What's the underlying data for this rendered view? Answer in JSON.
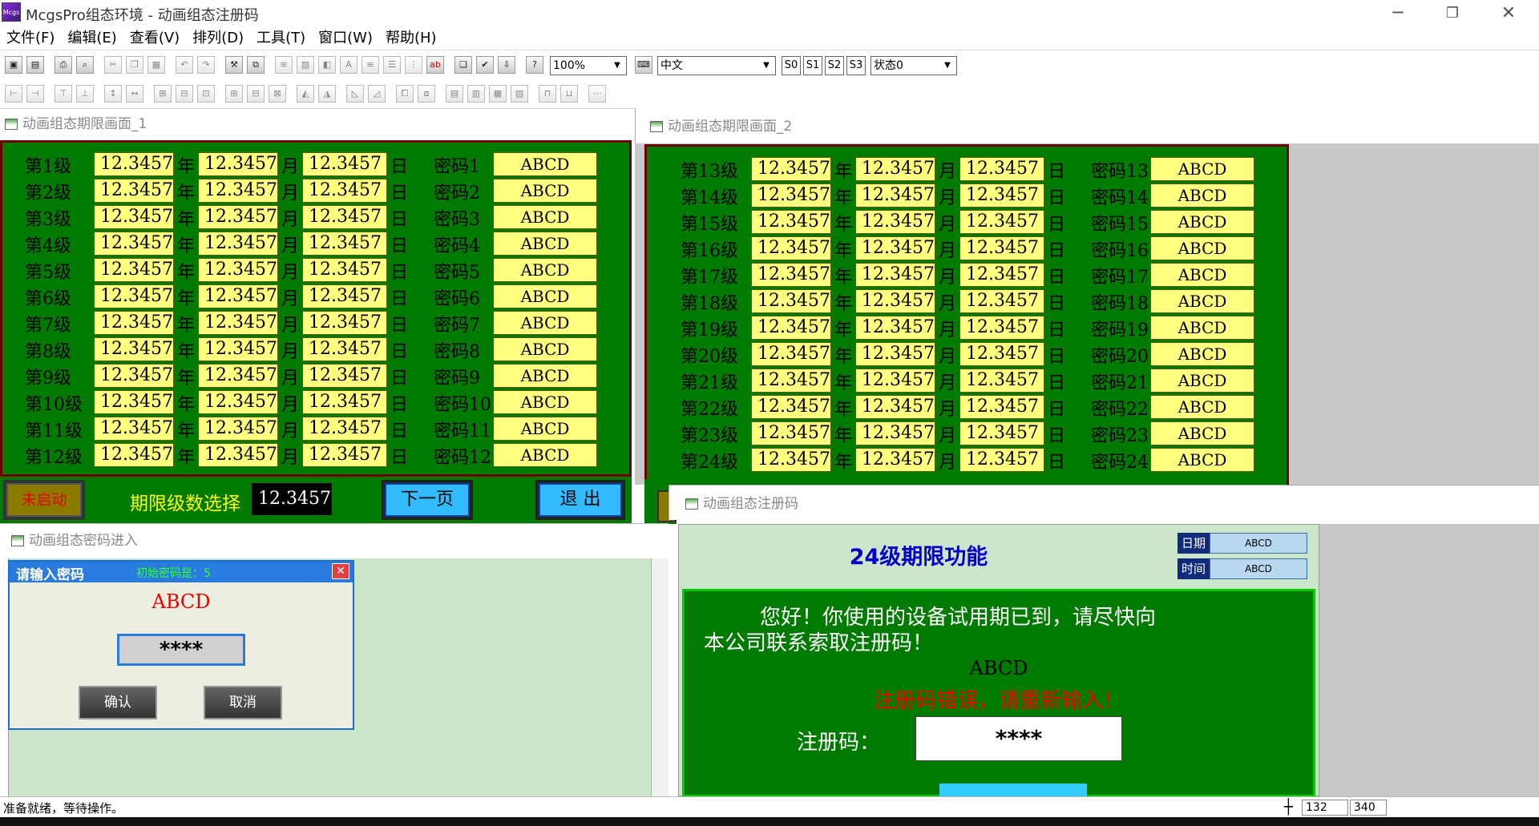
{
  "window": {
    "app_icon_text": "Mcgs",
    "title": "McgsPro组态环境 - 动画组态注册码"
  },
  "menu": [
    "文件(F)",
    "编辑(E)",
    "查看(V)",
    "排列(D)",
    "工具(T)",
    "窗口(W)",
    "帮助(H)"
  ],
  "toolbar": {
    "zoom": "100%",
    "language": "中文",
    "state_buttons": [
      "S0",
      "S1",
      "S2",
      "S3"
    ],
    "state_select": "状态0"
  },
  "window1": {
    "title": "动画组态期限画面_1",
    "rows": [
      {
        "level": "第1级",
        "year": "12.3457",
        "month": "12.3457",
        "day": "12.3457",
        "pwlabel": "密码1",
        "pw": "ABCD"
      },
      {
        "level": "第2级",
        "year": "12.3457",
        "month": "12.3457",
        "day": "12.3457",
        "pwlabel": "密码2",
        "pw": "ABCD"
      },
      {
        "level": "第3级",
        "year": "12.3457",
        "month": "12.3457",
        "day": "12.3457",
        "pwlabel": "密码3",
        "pw": "ABCD"
      },
      {
        "level": "第4级",
        "year": "12.3457",
        "month": "12.3457",
        "day": "12.3457",
        "pwlabel": "密码4",
        "pw": "ABCD"
      },
      {
        "level": "第5级",
        "year": "12.3457",
        "month": "12.3457",
        "day": "12.3457",
        "pwlabel": "密码5",
        "pw": "ABCD"
      },
      {
        "level": "第6级",
        "year": "12.3457",
        "month": "12.3457",
        "day": "12.3457",
        "pwlabel": "密码6",
        "pw": "ABCD"
      },
      {
        "level": "第7级",
        "year": "12.3457",
        "month": "12.3457",
        "day": "12.3457",
        "pwlabel": "密码7",
        "pw": "ABCD"
      },
      {
        "level": "第8级",
        "year": "12.3457",
        "month": "12.3457",
        "day": "12.3457",
        "pwlabel": "密码8",
        "pw": "ABCD"
      },
      {
        "level": "第9级",
        "year": "12.3457",
        "month": "12.3457",
        "day": "12.3457",
        "pwlabel": "密码9",
        "pw": "ABCD"
      },
      {
        "level": "第10级",
        "year": "12.3457",
        "month": "12.3457",
        "day": "12.3457",
        "pwlabel": "密码10",
        "pw": "ABCD"
      },
      {
        "level": "第11级",
        "year": "12.3457",
        "month": "12.3457",
        "day": "12.3457",
        "pwlabel": "密码11",
        "pw": "ABCD"
      },
      {
        "level": "第12级",
        "year": "12.3457",
        "month": "12.3457",
        "day": "12.3457",
        "pwlabel": "密码12",
        "pw": "ABCD"
      }
    ],
    "status_button": "未启动",
    "level_select_label": "期限级数选择",
    "level_select_value": "12.3457",
    "next_button": "下一页",
    "exit_button": "退 出"
  },
  "window2": {
    "title": "动画组态期限画面_2",
    "rows": [
      {
        "level": "第13级",
        "year": "12.3457",
        "month": "12.3457",
        "day": "12.3457",
        "pwlabel": "密码13",
        "pw": "ABCD"
      },
      {
        "level": "第14级",
        "year": "12.3457",
        "month": "12.3457",
        "day": "12.3457",
        "pwlabel": "密码14",
        "pw": "ABCD"
      },
      {
        "level": "第15级",
        "year": "12.3457",
        "month": "12.3457",
        "day": "12.3457",
        "pwlabel": "密码15",
        "pw": "ABCD"
      },
      {
        "level": "第16级",
        "year": "12.3457",
        "month": "12.3457",
        "day": "12.3457",
        "pwlabel": "密码16",
        "pw": "ABCD"
      },
      {
        "level": "第17级",
        "year": "12.3457",
        "month": "12.3457",
        "day": "12.3457",
        "pwlabel": "密码17",
        "pw": "ABCD"
      },
      {
        "level": "第18级",
        "year": "12.3457",
        "month": "12.3457",
        "day": "12.3457",
        "pwlabel": "密码18",
        "pw": "ABCD"
      },
      {
        "level": "第19级",
        "year": "12.3457",
        "month": "12.3457",
        "day": "12.3457",
        "pwlabel": "密码19",
        "pw": "ABCD"
      },
      {
        "level": "第20级",
        "year": "12.3457",
        "month": "12.3457",
        "day": "12.3457",
        "pwlabel": "密码20",
        "pw": "ABCD"
      },
      {
        "level": "第21级",
        "year": "12.3457",
        "month": "12.3457",
        "day": "12.3457",
        "pwlabel": "密码21",
        "pw": "ABCD"
      },
      {
        "level": "第22级",
        "year": "12.3457",
        "month": "12.3457",
        "day": "12.3457",
        "pwlabel": "密码22",
        "pw": "ABCD"
      },
      {
        "level": "第23级",
        "year": "12.3457",
        "month": "12.3457",
        "day": "12.3457",
        "pwlabel": "密码23",
        "pw": "ABCD"
      },
      {
        "level": "第24级",
        "year": "12.3457",
        "month": "12.3457",
        "day": "12.3457",
        "pwlabel": "密码24",
        "pw": "ABCD"
      }
    ]
  },
  "units": {
    "year": "年",
    "month": "月",
    "day": "日"
  },
  "password_window": {
    "title": "动画组态密码进入",
    "dialog_title": "请输入密码",
    "hint": "初始密码是：5",
    "message": "ABCD",
    "password": "****",
    "ok_button": "确认",
    "cancel_button": "取消"
  },
  "register_window": {
    "title": "动画组态注册码",
    "heading": "24级期限功能",
    "date_label": "日期",
    "date_value": "ABCD",
    "time_label": "时间",
    "time_value": "ABCD",
    "message_line1": "您好！你使用的设备试用期已到，请尽快向",
    "message_line2": "本公司联系索取注册码！",
    "code_text": "ABCD",
    "error_text": "注册码错误，请重新输入！",
    "reg_label": "注册码：",
    "reg_value": "****"
  },
  "status": {
    "text": "准备就绪，等待操作。",
    "x": "132",
    "y": "340"
  }
}
